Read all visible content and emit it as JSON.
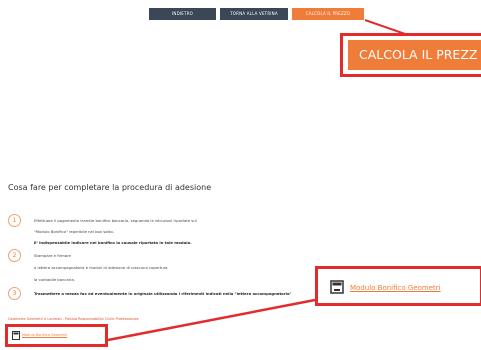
{
  "toolbar": {
    "reset_label": "INDIETRO",
    "back_label": "TORNA ALLA VETRINA",
    "calc_label": "CALCOLA IL PREZZO"
  },
  "zoom": {
    "calc_label": "CALCOLA IL PREZZ"
  },
  "procedure": {
    "heading": "Cosa fare per completare la procedura di adesione",
    "steps": [
      {
        "number": "1",
        "lines": [
          "Effettuare il pagamento tramite bonifico bancario, seguendo le istruzioni riportate sul",
          "\"Modulo Bonifico\" reperibile nel box sotto.",
          "E' indispensabile indicare nel bonifico la causale riportata in tale modulo."
        ]
      },
      {
        "number": "2",
        "lines": [
          "Stampare e firmare",
          "a lettera accompagnatoria e moduli di adesione di ciascuna copertura",
          "la contabile bancaria."
        ]
      },
      {
        "number": "3",
        "lines": [
          "Trasmettere a mezzo fax ed eventualmente in originale utilizzando i riferimenti indicati nella \"lettera accompagnatoria\""
        ]
      }
    ],
    "note": "Geometra Geometri e Laureati - Polizza Responsabilita Civile Professionale"
  },
  "files": {
    "small_label": "Modulo Bonifico Geometri",
    "big_label": "Modulo Bonifico Geometri"
  },
  "colors": {
    "accent": "#f07c3a",
    "dark": "#3a4756",
    "highlight": "#e32b2b"
  }
}
